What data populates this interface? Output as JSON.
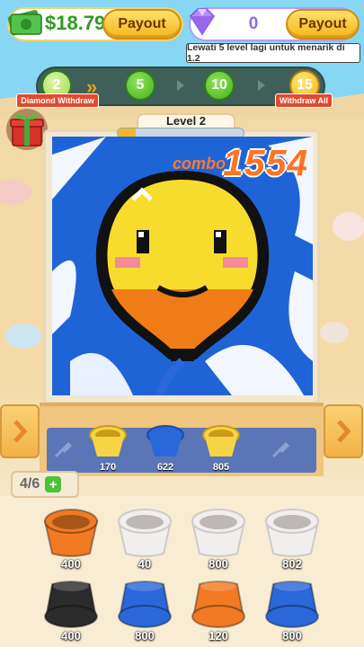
{
  "top_bar": {
    "cash_amount": "$18.79",
    "payout_label_1": "Payout",
    "gem_count": "0",
    "payout_label_2": "Payout",
    "hint": "Lewati 5 level lagi untuk menarik di 1.2"
  },
  "progress": {
    "nodes": [
      "2",
      "5",
      "10",
      "15"
    ],
    "tag_left": "Diamond Withdraw",
    "tag_right": "Withdraw All"
  },
  "level": {
    "label": "Level 2",
    "progress_fraction": 0.14
  },
  "combo": {
    "word": "combo",
    "number": "1554"
  },
  "conveyor": {
    "slots": [
      "170",
      "622",
      "805"
    ]
  },
  "counter": {
    "text": "4/6",
    "plus": "+"
  },
  "cups": {
    "row1": [
      "400",
      "40",
      "800",
      "802"
    ],
    "row2": [
      "400",
      "800",
      "120",
      "800"
    ]
  },
  "colors": {
    "orange": "#f17a23",
    "white": "#f1eeee",
    "black": "#2b2b2b",
    "blue": "#2a67d8",
    "yellow": "#f7d445"
  }
}
